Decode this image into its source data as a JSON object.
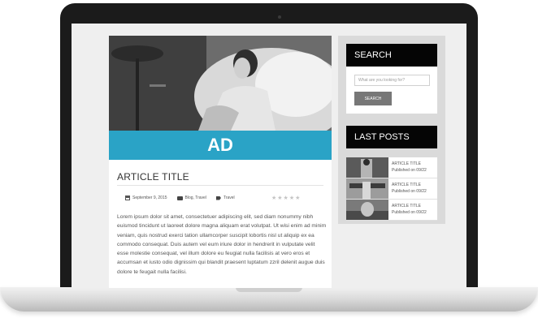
{
  "ad": {
    "label": "AD"
  },
  "article": {
    "title": "ARTICLE TITLE",
    "date": "September 9, 2015",
    "categories": "Blog, Travel",
    "tag": "Travel",
    "rating_stars": "★★★★★",
    "body": "Lorem ipsum dolor sit amet, consectetuer adipiscing elit, sed diam nonummy nibh euismod tincidunt ut laoreet dolore magna aliquam erat volutpat. Ut wisi enim ad minim veniam, quis nostrud exerci tation ullamcorper suscipit lobortis nisl ut aliquip ex ea commodo consequat. Duis autem vel eum iriure dolor in hendrerit in vulputate velit esse molestie consequat, vel illum dolore eu feugiat nulla facilisis at vero eros et accumsan et iusto odio dignissim qui blandit praesent luptatum zzril delenit augue duis dolore te feugait nulla facilisi."
  },
  "sidebar": {
    "search": {
      "heading": "SEARCH",
      "placeholder": "What are you looking for?",
      "button": "SEARCH"
    },
    "last_posts": {
      "heading": "LAST POSTS",
      "items": [
        {
          "title": "ARTICLE TITLE",
          "date": "Published on 09/22"
        },
        {
          "title": "ARTICLE TITLE",
          "date": "Published on 09/22"
        },
        {
          "title": "ARTICLE TITLE",
          "date": "Published on 09/22"
        }
      ]
    }
  },
  "colors": {
    "accent": "#2aa3c6",
    "widget_header": "#050505",
    "button": "#777777"
  }
}
